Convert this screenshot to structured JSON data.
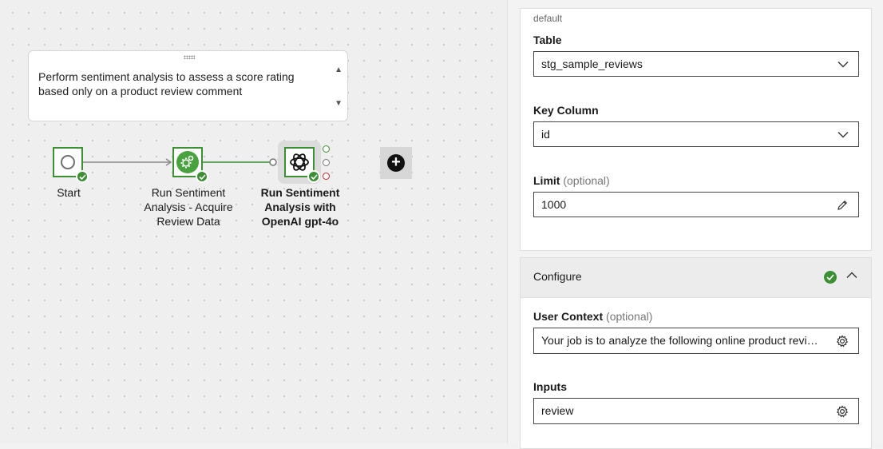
{
  "canvas": {
    "note": {
      "text": "Perform sentiment analysis to assess a score rating based only on a product review comment"
    },
    "nodes": [
      {
        "id": "start",
        "label": "Start",
        "status": "success"
      },
      {
        "id": "acquire",
        "label": "Run Sentiment Analysis - Acquire Review Data",
        "status": "success"
      },
      {
        "id": "openai",
        "label": "Run Sentiment Analysis with OpenAI gpt-4o",
        "status": "success",
        "selected": true
      }
    ],
    "add_button_icon": "plus-circle-icon"
  },
  "panel": {
    "top_card": {
      "partial_text": "default",
      "table": {
        "label": "Table",
        "value": "stg_sample_reviews",
        "icon": "chevron-down-icon"
      },
      "key_column": {
        "label": "Key Column",
        "value": "id",
        "icon": "chevron-down-icon"
      },
      "limit": {
        "label": "Limit",
        "optional": "(optional)",
        "value": "1000",
        "icon": "pencil-icon"
      }
    },
    "configure": {
      "title": "Configure",
      "status": "valid",
      "user_context": {
        "label": "User Context",
        "optional": "(optional)",
        "value": "Your job is to analyze the following online product review",
        "icon": "gear-icon"
      },
      "inputs": {
        "label": "Inputs",
        "value": "review",
        "icon": "gear-icon"
      }
    }
  },
  "colors": {
    "success": "#3c8f33",
    "error": "#c62828",
    "accent": "#48a23d"
  }
}
